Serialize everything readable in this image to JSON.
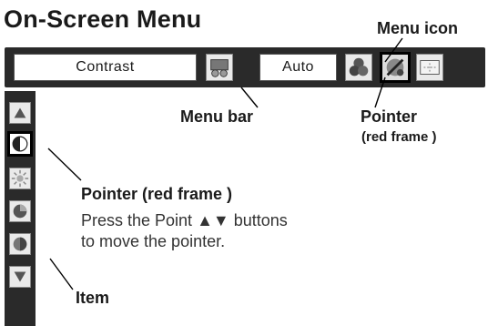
{
  "title": "On-Screen Menu",
  "menu_bar": {
    "item_field": "Contrast",
    "value_field": "Auto",
    "icons": [
      "film-reel-icon",
      "color-balls-icon",
      "image-adjust-icon",
      "screen-icon"
    ],
    "selected_icon": "image-adjust-icon"
  },
  "sidebar": {
    "items": [
      "up-arrow-icon",
      "contrast-icon",
      "brightness-icon",
      "color-icon",
      "tint-icon",
      "down-arrow-icon"
    ],
    "selected_item": "contrast-icon"
  },
  "callouts": {
    "menu_icon": "Menu icon",
    "menu_bar": "Menu bar",
    "pointer_top": "Pointer",
    "pointer_top_sub": "(red frame )",
    "pointer_left": "Pointer (red frame )",
    "pointer_left_desc_line1": "Press the Point ▲▼ buttons",
    "pointer_left_desc_line2": "to move the pointer.",
    "item": "Item"
  }
}
